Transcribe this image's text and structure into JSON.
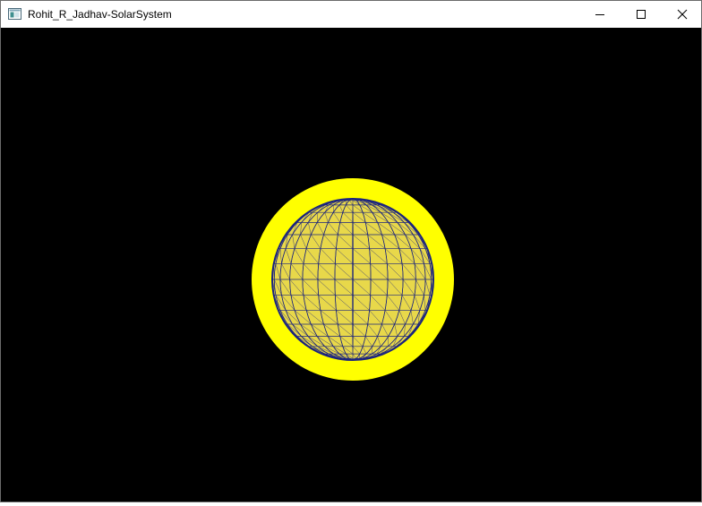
{
  "window": {
    "title": "Rohit_R_Jadhav-SolarSystem",
    "icon": "app-window-icon",
    "controls": {
      "minimize_icon": "minimize-icon",
      "maximize_icon": "maximize-icon",
      "close_icon": "close-icon"
    }
  },
  "scene": {
    "background_color": "#000000",
    "sun": {
      "outer_color": "#ffff00",
      "wireframe_color": "#1a237e",
      "fill_color": "#e8d84a"
    }
  }
}
